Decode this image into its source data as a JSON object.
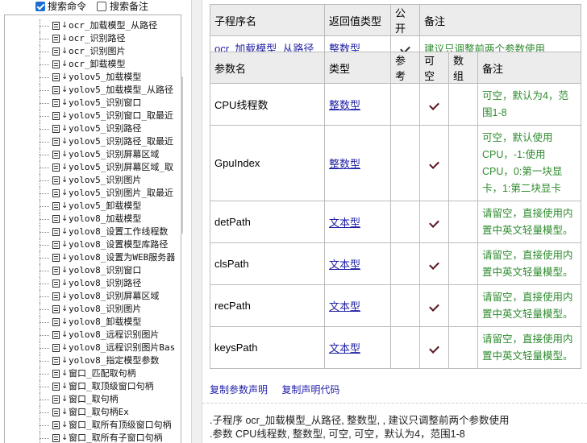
{
  "search": {
    "command_label": "搜索命令",
    "command_checked": true,
    "note_label": "搜索备注",
    "note_checked": false
  },
  "tree": {
    "items": [
      "ocr_加载模型_从路径",
      "ocr_识别路径",
      "ocr_识别图片",
      "ocr_卸载模型",
      "yolov5_加载模型",
      "yolov5_加载模型_从路径",
      "yolov5_识别窗口",
      "yolov5_识别窗口_取最近",
      "yolov5_识别路径",
      "yolov5_识别路径_取最近",
      "yolov5_识别屏幕区域",
      "yolov5_识别屏幕区域_取",
      "yolov5_识别图片",
      "yolov5_识别图片_取最近",
      "yolov5_卸载模型",
      "yolov8_加载模型",
      "yolov8_设置工作线程数",
      "yolov8_设置模型库路径",
      "yolov8_设置为WEB服务器",
      "yolov8_识别窗口",
      "yolov8_识别路径",
      "yolov8_识别屏幕区域",
      "yolov8_识别图片",
      "yolov8_卸载模型",
      "yolov8_远程识别图片",
      "yolov8_远程识别图片Bas",
      "yolov8_指定模型参数",
      "窗口_匹配取句柄",
      "窗口_取顶级窗口句柄",
      "窗口_取句柄",
      "窗口_取句柄Ex",
      "窗口_取所有顶级窗口句柄",
      "窗口_取所有子窗口句柄"
    ]
  },
  "sub": {
    "headers": [
      "子程序名",
      "返回值类型",
      "公开",
      "备注"
    ],
    "name": "ocr_加载模型_从路径",
    "return_type": "整数型",
    "public": true,
    "note": "建议只调整前两个参数使用"
  },
  "params": {
    "headers": [
      "参数名",
      "类型",
      "参考",
      "可空",
      "数组",
      "备注"
    ],
    "rows": [
      {
        "name": "CPU线程数",
        "type": "整数型",
        "nullable": true,
        "note": "可空，默认为4，范围1-8"
      },
      {
        "name": "GpuIndex",
        "type": "整数型",
        "nullable": true,
        "note": "可空，默认使用CPU，-1:使用CPU，0:第一块显卡，1:第二块显卡"
      },
      {
        "name": "detPath",
        "type": "文本型",
        "nullable": true,
        "note": "请留空，直接使用内置中英文轻量模型。"
      },
      {
        "name": "clsPath",
        "type": "文本型",
        "nullable": true,
        "note": "请留空，直接使用内置中英文轻量模型。"
      },
      {
        "name": "recPath",
        "type": "文本型",
        "nullable": true,
        "note": "请留空，直接使用内置中英文轻量模型。"
      },
      {
        "name": "keysPath",
        "type": "文本型",
        "nullable": true,
        "note": "请留空，直接使用内置中英文轻量模型。"
      }
    ]
  },
  "links": {
    "copy_declaration": "复制参数声明",
    "copy_code": "复制声明代码"
  },
  "code": {
    "line1": ".子程序 ocr_加载模型_从路径, 整数型, , 建议只调整前两个参数使用",
    "line2": ".参数 CPU线程数, 整数型, 可空, 可空，默认为4，范围1-8"
  },
  "colors": {
    "link_blue": "#1f1fa6",
    "note_green": "#2e8b2e",
    "header_gray": "#ececec"
  }
}
